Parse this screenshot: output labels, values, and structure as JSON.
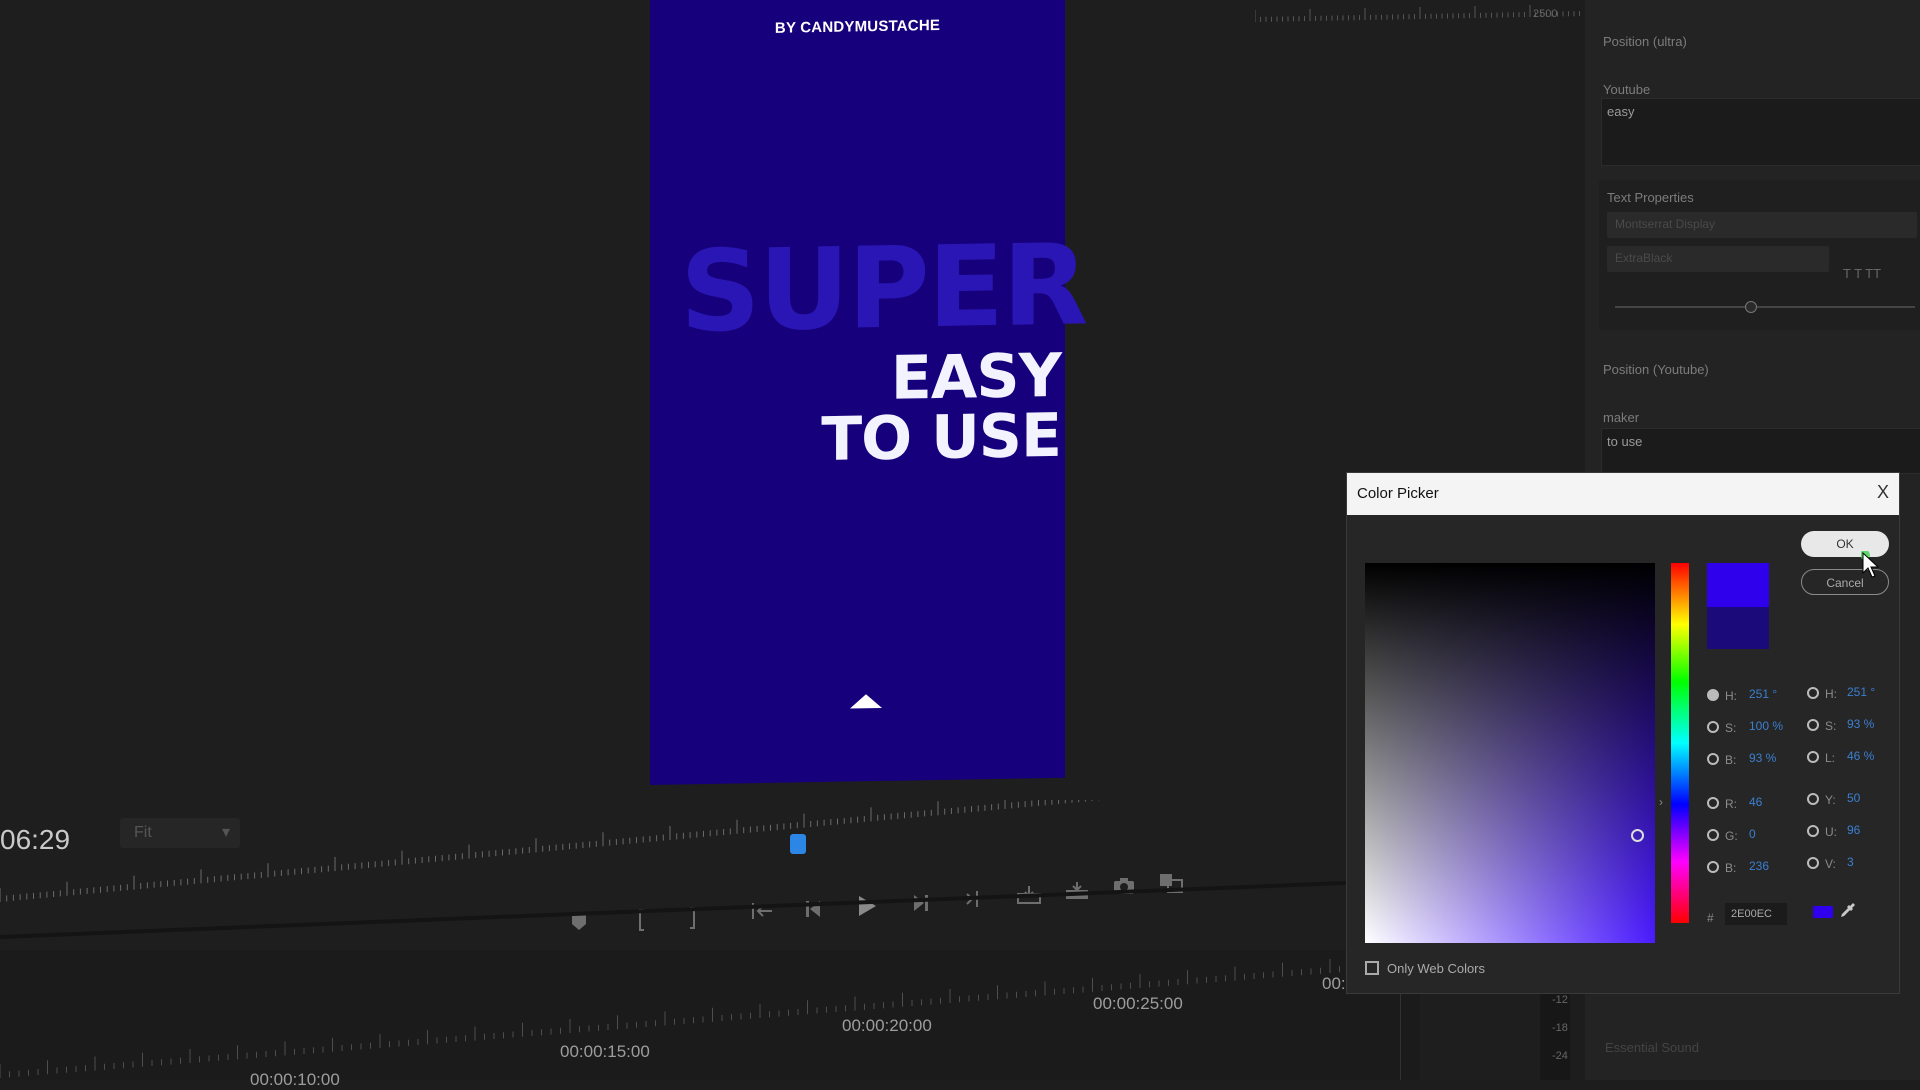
{
  "monitor": {
    "timecode": "06:29",
    "fit_label": "Fit",
    "video": {
      "byline": "BY CANDYMUSTACHE",
      "headline_bg": "SUPER",
      "headline_1": "EASY",
      "headline_2": "TO USE",
      "background_color": "#16007c"
    },
    "playhead_color": "#2b86e6"
  },
  "timeline": {
    "times": [
      "00:00:10:00",
      "00:00:15:00",
      "00:00:20:00",
      "00:00:25:00",
      "00:0"
    ],
    "meter_labels": [
      "-12",
      "-18",
      "-24"
    ]
  },
  "right_panel": {
    "ruler_label": "2500",
    "position_ultra_label": "Position (ultra)",
    "youtube_label": "Youtube",
    "youtube_value": "easy",
    "text_properties_label": "Text Properties",
    "font_placeholder": "Montserrat Display",
    "font_style_placeholder": "ExtraBlack",
    "style_buttons": "T  T  TT",
    "position_youtube_label": "Position (Youtube)",
    "maker_label": "maker",
    "maker_value": "to use",
    "essential_sound_label": "Essential Sound"
  },
  "color_picker": {
    "title": "Color Picker",
    "close_glyph": "X",
    "ok_label": "OK",
    "cancel_label": "Cancel",
    "new_color": "#2e00ec",
    "old_color": "#1a0a7a",
    "hsb": [
      {
        "label": "H:",
        "value": "251 °"
      },
      {
        "label": "S:",
        "value": "100 %"
      },
      {
        "label": "B:",
        "value": "93 %"
      }
    ],
    "rgb": [
      {
        "label": "R:",
        "value": "46"
      },
      {
        "label": "G:",
        "value": "0"
      },
      {
        "label": "B:",
        "value": "236"
      }
    ],
    "hsl": [
      {
        "label": "H:",
        "value": "251 °"
      },
      {
        "label": "S:",
        "value": "93 %"
      },
      {
        "label": "L:",
        "value": "46 %"
      }
    ],
    "yuv": [
      {
        "label": "Y:",
        "value": "50"
      },
      {
        "label": "U:",
        "value": "96"
      },
      {
        "label": "V:",
        "value": "3"
      }
    ],
    "hex_hash": "#",
    "hex_value": "2E00EC",
    "only_web_colors_label": "Only Web Colors"
  }
}
